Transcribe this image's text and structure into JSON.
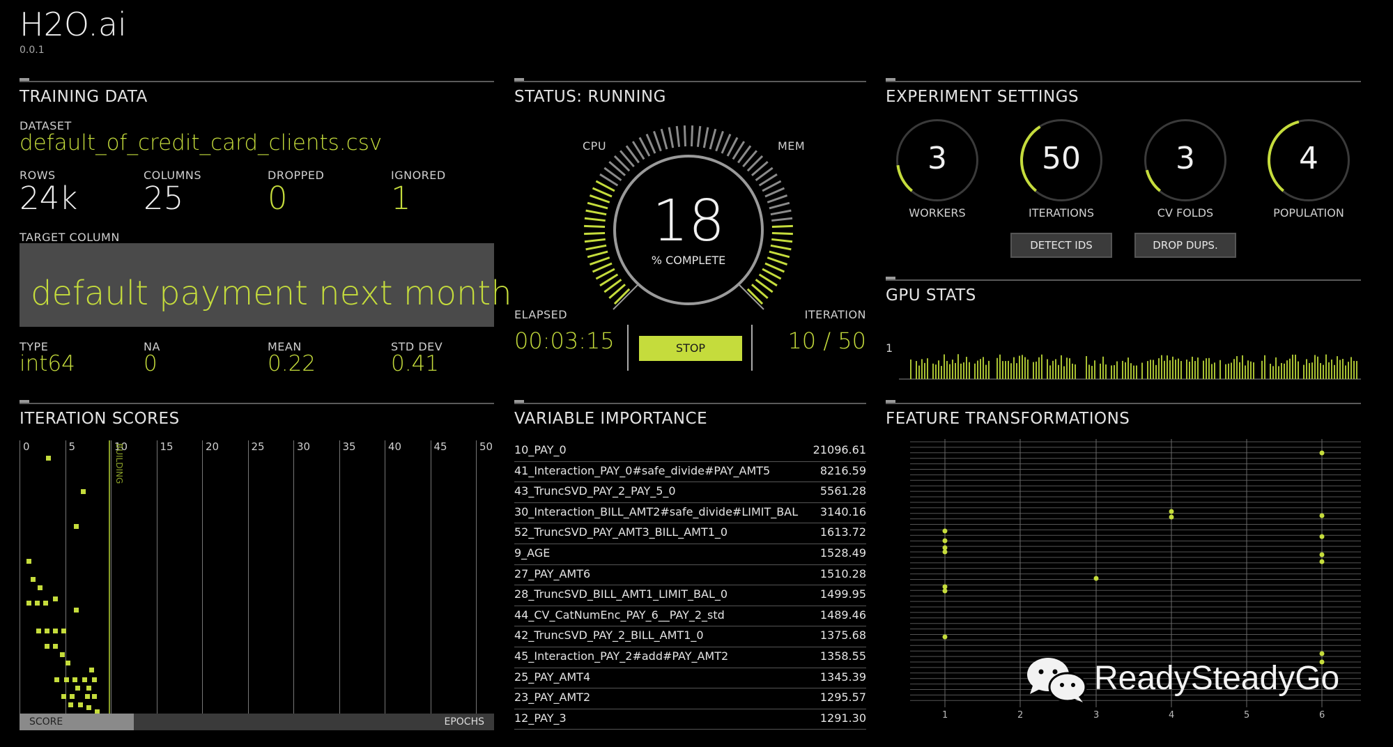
{
  "app": {
    "title": "H2O.ai",
    "version": "0.0.1"
  },
  "training": {
    "title": "TRAINING DATA",
    "dataset_label": "DATASET",
    "dataset": "default_of_credit_card_clients.csv",
    "rows_label": "ROWS",
    "rows": "24k",
    "columns_label": "COLUMNS",
    "columns": "25",
    "dropped_label": "DROPPED",
    "dropped": "0",
    "ignored_label": "IGNORED",
    "ignored": "1",
    "target_label": "TARGET COLUMN",
    "target": "default payment next month",
    "type_label": "TYPE",
    "type": "int64",
    "na_label": "NA",
    "na": "0",
    "mean_label": "MEAN",
    "mean": "0.22",
    "std_label": "STD DEV",
    "std": "0.41"
  },
  "status": {
    "title": "STATUS: RUNNING",
    "cpu_label": "CPU",
    "mem_label": "MEM",
    "complete": "18",
    "complete_label": "% COMPLETE",
    "elapsed_label": "ELAPSED",
    "elapsed": "00:03:15",
    "iteration_label": "ITERATION",
    "iteration": "10 / 50",
    "stop_label": "STOP",
    "cpu_level": 0.55,
    "mem_level": 0.35
  },
  "settings": {
    "title": "EXPERIMENT SETTINGS",
    "dials": [
      {
        "value": "3",
        "label": "WORKERS",
        "level": 0.12
      },
      {
        "value": "50",
        "label": "ITERATIONS",
        "level": 0.3
      },
      {
        "value": "3",
        "label": "CV FOLDS",
        "level": 0.1
      },
      {
        "value": "4",
        "label": "POPULATION",
        "level": 0.35
      }
    ],
    "detect_ids_label": "DETECT IDS",
    "drop_dups_label": "DROP DUPS."
  },
  "gpu": {
    "title": "GPU STATS",
    "axis_label": "1"
  },
  "scores": {
    "title": "ITERATION SCORES",
    "ticks": [
      "0",
      "5",
      "10",
      "15",
      "20",
      "25",
      "30",
      "35",
      "40",
      "45",
      "50"
    ],
    "building_label": "BUILDING",
    "score_label": "SCORE",
    "epochs_label": "EPOCHS"
  },
  "importance": {
    "title": "VARIABLE IMPORTANCE",
    "rows": [
      {
        "name": "10_PAY_0",
        "value": "21096.61"
      },
      {
        "name": "41_Interaction_PAY_0#safe_divide#PAY_AMT5",
        "value": "8216.59"
      },
      {
        "name": "43_TruncSVD_PAY_2_PAY_5_0",
        "value": "5561.28"
      },
      {
        "name": "30_Interaction_BILL_AMT2#safe_divide#LIMIT_BAL",
        "value": "3140.16"
      },
      {
        "name": "52_TruncSVD_PAY_AMT3_BILL_AMT1_0",
        "value": "1613.72"
      },
      {
        "name": "9_AGE",
        "value": "1528.49"
      },
      {
        "name": "27_PAY_AMT6",
        "value": "1510.28"
      },
      {
        "name": "28_TruncSVD_BILL_AMT1_LIMIT_BAL_0",
        "value": "1499.95"
      },
      {
        "name": "44_CV_CatNumEnc_PAY_6__PAY_2_std",
        "value": "1489.46"
      },
      {
        "name": "42_TruncSVD_PAY_2_BILL_AMT1_0",
        "value": "1375.68"
      },
      {
        "name": "45_Interaction_PAY_2#add#PAY_AMT2",
        "value": "1358.55"
      },
      {
        "name": "25_PAY_AMT4",
        "value": "1345.39"
      },
      {
        "name": "23_PAY_AMT2",
        "value": "1295.57"
      },
      {
        "name": "12_PAY_3",
        "value": "1291.30"
      }
    ]
  },
  "features": {
    "title": "FEATURE TRANSFORMATIONS",
    "x_ticks": [
      "1",
      "2",
      "3",
      "4",
      "5",
      "6"
    ]
  },
  "watermark": {
    "text": "ReadySteadyGo"
  }
}
